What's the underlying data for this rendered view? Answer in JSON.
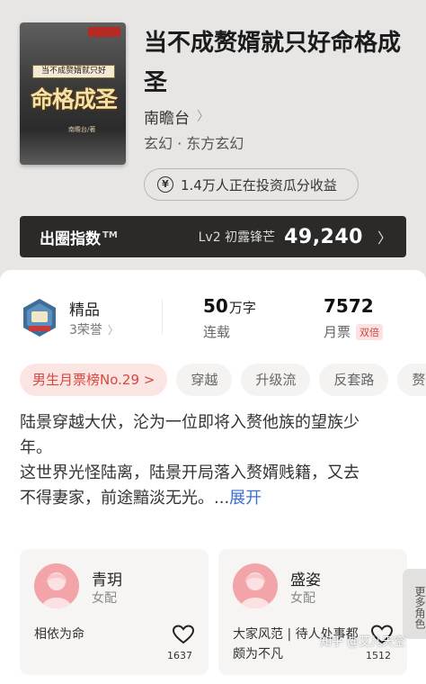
{
  "book": {
    "title": "当不成赘婿就只好命格成圣",
    "author": "南瞻台",
    "genre": "玄幻 · 东方玄幻",
    "invest_text": "1.4万人正在投资瓜分收益"
  },
  "cover": {
    "subtitle": "当不成赘婿就只好",
    "title": "命格成圣",
    "author_tag": "南瞻台/著"
  },
  "index_bar": {
    "label": "出圈指数",
    "tm": "TM",
    "level": "Lv2 初露锋芒",
    "value": "49,240"
  },
  "stats": {
    "quality": "精品",
    "honors": "3荣誉",
    "words_num": "50",
    "words_unit": "万字",
    "words_label": "连载",
    "tickets_num": "7572",
    "tickets_label": "月票",
    "double_badge": "双倍"
  },
  "tags": [
    "男生月票榜No.29 >",
    "穿越",
    "升级流",
    "反套路",
    "赘"
  ],
  "synopsis": {
    "lines": [
      "陆景穿越大伏，沦为一位即将入赘他族的望族少",
      "年。",
      "这世界光怪陆离，陆景开局落入赘婿贱籍，又去",
      "不得妻家，前途黯淡无光。..."
    ],
    "expand": "展开"
  },
  "roles": [
    {
      "name": "青玥",
      "type": "女配",
      "desc": "相依为命",
      "likes": "1637"
    },
    {
      "name": "盛姿",
      "type": "女配",
      "desc": "大家风范 | 待人处事都颇为不凡",
      "likes": "1512"
    }
  ],
  "more_roles": "更多角色",
  "watermark": "知乎 @艾儿天空",
  "colors": {
    "accent_red": "#d9473f",
    "link_blue": "#3b6fd4",
    "index_bar_bg": "#2b2a29"
  },
  "icons": [
    "yen-coin-icon",
    "chevron-right-icon",
    "quality-badge-icon",
    "heart-icon",
    "avatar-silhouette-icon"
  ]
}
